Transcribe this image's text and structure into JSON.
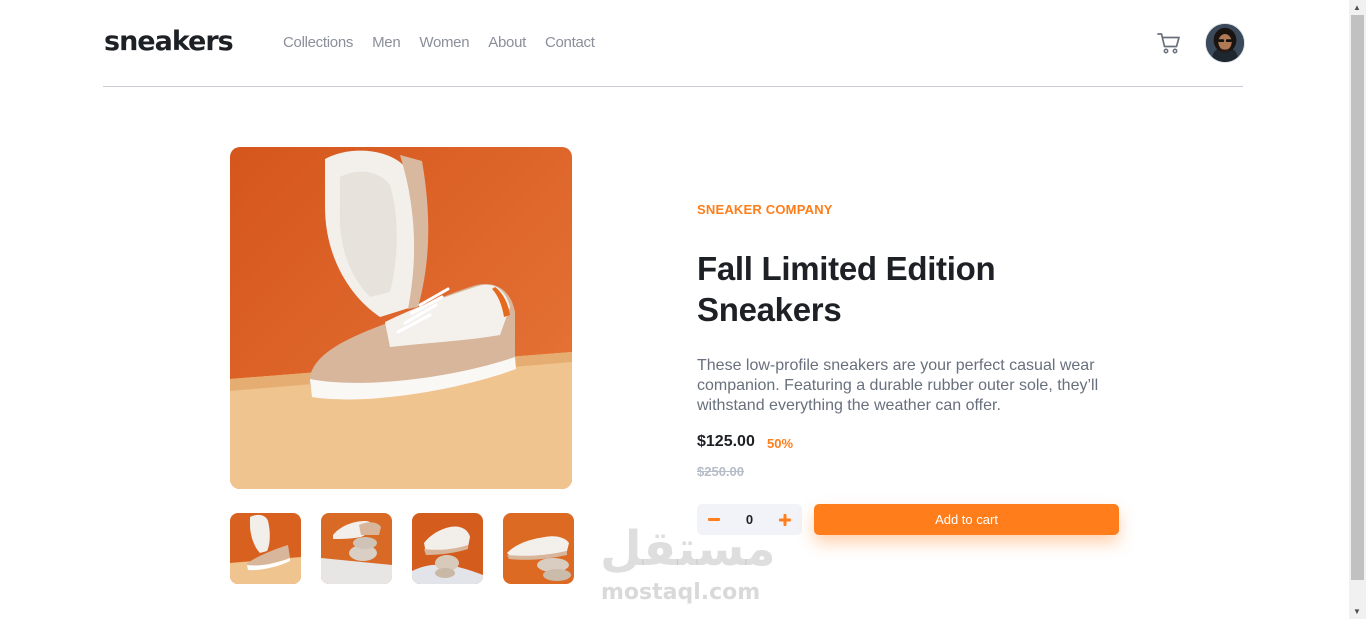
{
  "header": {
    "logo": "sneakers",
    "nav": [
      "Collections",
      "Men",
      "Women",
      "About",
      "Contact"
    ],
    "cart_icon": "cart-icon",
    "avatar_icon": "user-avatar"
  },
  "gallery": {
    "thumbnails": [
      "thumbnail-1",
      "thumbnail-2",
      "thumbnail-3",
      "thumbnail-4"
    ]
  },
  "product": {
    "company": "SNEAKER COMPANY",
    "title": "Fall Limited Edition Sneakers",
    "description": "These low-profile sneakers are your perfect casual wear companion. Featuring a durable rubber outer sole, they’ll withstand everything the weather can offer.",
    "price": "$125.00",
    "discount": "50%",
    "old_price": "$250.00",
    "quantity": "0",
    "add_to_cart": "Add to cart"
  },
  "watermark": {
    "arabic": "مستقل",
    "latin": "mostaql.com"
  },
  "colors": {
    "accent": "#ff7d1a",
    "text_dark": "#1d2025",
    "text_muted": "#68707d"
  }
}
